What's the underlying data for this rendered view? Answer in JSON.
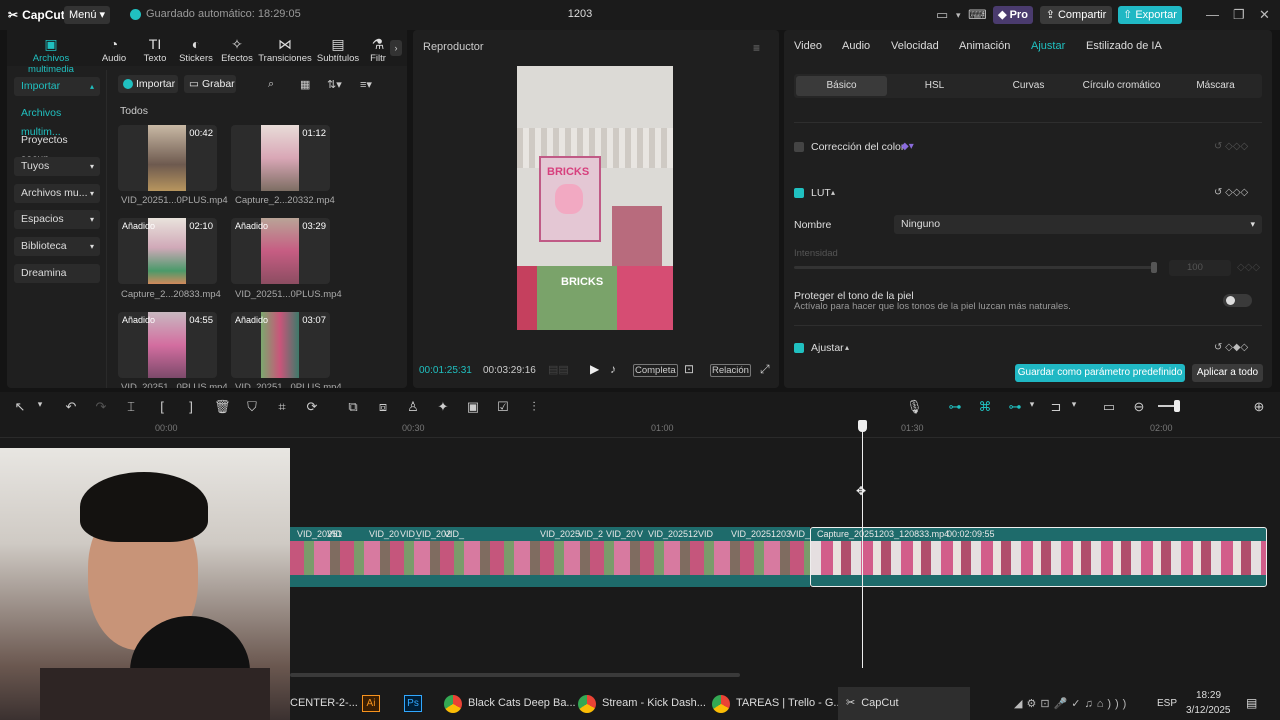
{
  "app": {
    "name": "CapCut",
    "menu_label": "Menú",
    "autosave": "Guardado automático: 18:29:05",
    "project_title": "1203",
    "pro_label": "Pro",
    "share_label": "Compartir",
    "export_label": "Exportar"
  },
  "tools": [
    {
      "label": "Archivos multimedia",
      "icon": "media-icon"
    },
    {
      "label": "Audio",
      "icon": "audio-icon"
    },
    {
      "label": "Texto",
      "icon": "text-icon"
    },
    {
      "label": "Stickers",
      "icon": "sticker-icon"
    },
    {
      "label": "Efectos",
      "icon": "effects-icon"
    },
    {
      "label": "Transiciones",
      "icon": "transitions-icon"
    },
    {
      "label": "Subtítulos",
      "icon": "subtitles-icon"
    },
    {
      "label": "Filtr",
      "icon": "filters-icon"
    }
  ],
  "sidebar": {
    "items": [
      "Importar",
      "Archivos multim...",
      "Proyectos secun...",
      "Tuyos",
      "Archivos mu...",
      "Espacios",
      "Biblioteca",
      "Dreamina"
    ]
  },
  "media": {
    "import_label": "Importar",
    "record_label": "Grabar",
    "filter_label": "Todos",
    "items": [
      {
        "name": "VID_20251...0PLUS.mp4",
        "duration": "00:42",
        "added": ""
      },
      {
        "name": "Capture_2...20332.mp4",
        "duration": "01:12",
        "added": ""
      },
      {
        "name": "Capture_2...20833.mp4",
        "duration": "02:10",
        "added": "Añadido"
      },
      {
        "name": "VID_20251...0PLUS.mp4",
        "duration": "03:29",
        "added": "Añadido"
      },
      {
        "name": "VID_20251...0PLUS.mp4",
        "duration": "04:55",
        "added": "Añadido"
      },
      {
        "name": "VID_20251...0PLUS.mp4",
        "duration": "03:07",
        "added": "Añadido"
      }
    ]
  },
  "player": {
    "title": "Reproductor",
    "current_time": "00:01:25:31",
    "total_time": "00:03:29:16",
    "full_label": "Completa",
    "ratio_label": "Relación"
  },
  "props": {
    "tabs": [
      "Video",
      "Audio",
      "Velocidad",
      "Animación",
      "Ajustar",
      "Estilizado de IA"
    ],
    "active_tab": "Ajustar",
    "subtabs": [
      "Básico",
      "HSL",
      "Curvas",
      "Círculo cromático",
      "Máscara"
    ],
    "color_correction": "Corrección del color",
    "lut": "LUT",
    "name_label": "Nombre",
    "name_value": "Ninguno",
    "intensity_label": "Intensidad",
    "intensity_value": "100",
    "skin_title": "Proteger el tono de la piel",
    "skin_desc": "Actívalo para hacer que los tonos de la piel luzcan más naturales.",
    "adjust": "Ajustar",
    "save_preset": "Guardar como parámetro predefinido",
    "apply_all": "Aplicar a todo"
  },
  "timeline": {
    "ruler": [
      "00:00",
      "00:30",
      "01:00",
      "01:30",
      "02:00"
    ],
    "clips": [
      "VID_20251",
      "VID",
      "VID_20",
      "VID_",
      "VID_202",
      "VID_",
      "VID_2025",
      "VID_2",
      "VID_20",
      "V",
      "VID_202512",
      "VID",
      "VID_20251203",
      "VID_"
    ],
    "main_clip": "Capture_20251203_120833.mp4",
    "main_clip_duration": "00:02:09:55"
  },
  "taskbar": {
    "items": [
      "CENTER-2-...",
      "",
      "",
      "Black Cats Deep Ba...",
      "Stream - Kick Dash...",
      "TAREAS | Trello - G...",
      "CapCut"
    ],
    "lang": "ESP",
    "time": "18:29",
    "date": "3/12/2025"
  },
  "colors": {
    "accent": "#20c0c0",
    "export": "#20b8c4",
    "pro": "#4a3b6e",
    "clip": "#1f6f6f"
  }
}
